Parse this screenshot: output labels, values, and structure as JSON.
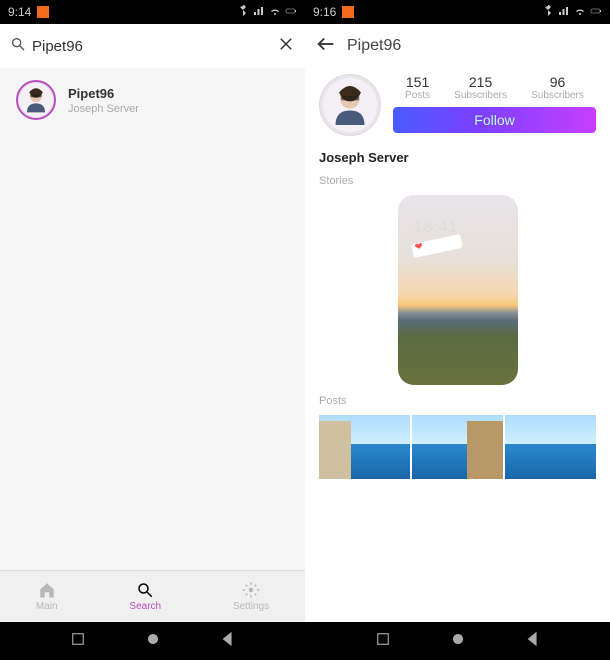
{
  "status_bar": {
    "left_time": "9:14",
    "right_time": "9:16"
  },
  "search": {
    "value": "Pipet96",
    "result": {
      "username": "Pipet96",
      "display_name": "Joseph Server"
    }
  },
  "bottom_nav": {
    "main": "Main",
    "search": "Search",
    "settings": "Settings"
  },
  "profile": {
    "title": "Pipet96",
    "stats": {
      "posts_num": "151",
      "posts_label": "Posts",
      "subs_num": "215",
      "subs_label": "Subscribers",
      "following_num": "96",
      "following_label": "Subscribers"
    },
    "follow_btn": "Follow",
    "display_name": "Joseph Server",
    "stories_label": "Stories",
    "story_time": "18:41",
    "posts_label": "Posts"
  }
}
